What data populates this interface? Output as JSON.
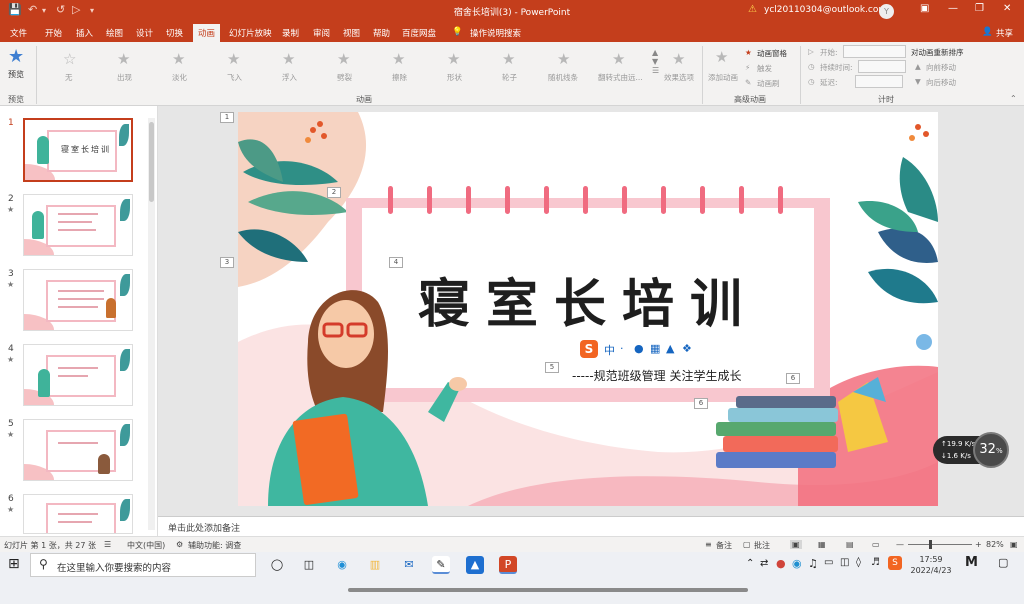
{
  "titlebar": {
    "doc_title": "宿舍长培训(3)  -  PowerPoint",
    "account": "ycl20110304@outlook.com",
    "avatar_letter": "Y",
    "share_label": "共享",
    "warning_icon": "warning-icon"
  },
  "ribbon_tabs": [
    "文件",
    "开始",
    "插入",
    "绘图",
    "设计",
    "切换",
    "动画",
    "幻灯片放映",
    "录制",
    "审阅",
    "视图",
    "帮助",
    "百度网盘"
  ],
  "active_tab": "动画",
  "tell_me": "操作说明搜索",
  "ribbon": {
    "preview": {
      "label": "预览",
      "group": "预览"
    },
    "effects": [
      "无",
      "出现",
      "淡化",
      "飞入",
      "浮入",
      "劈裂",
      "擦除",
      "形状",
      "轮子",
      "随机线条",
      "翻转式由远..."
    ],
    "effect_options": "效果选项",
    "animation_group": "动画",
    "add_animation": "添加动画",
    "animation_pane": "动画窗格",
    "trigger": "触发",
    "animation_painter": "动画刷",
    "advanced_group": "高级动画",
    "start": "开始:",
    "duration": "持续时间:",
    "delay": "延迟:",
    "reorder": "对动画重新排序",
    "move_earlier": "向前移动",
    "move_later": "向后移动",
    "timing_group": "计时"
  },
  "thumbnails": [
    {
      "num": "1",
      "star": "",
      "title": "寝室长培训"
    },
    {
      "num": "2",
      "star": "★",
      "title": ""
    },
    {
      "num": "3",
      "star": "★",
      "title": ""
    },
    {
      "num": "4",
      "star": "★",
      "title": ""
    },
    {
      "num": "5",
      "star": "★",
      "title": ""
    },
    {
      "num": "6",
      "star": "★",
      "title": ""
    }
  ],
  "slide": {
    "title": "寝室长培训",
    "subtitle": "-----规范班级管理 关注学生成长",
    "anim_tags": [
      "1",
      "2",
      "3",
      "4",
      "5",
      "6",
      "6"
    ],
    "ime_bar": [
      "中",
      "·",
      "mic",
      "grid",
      "shirt",
      "apps"
    ]
  },
  "notes_placeholder": "单击此处添加备注",
  "status": {
    "slide_info": "幻灯片 第 1 张，共 27 张",
    "language": "中文(中国)",
    "accessibility": "辅助功能: 调查",
    "notes": "备注",
    "comments": "批注",
    "zoom": "82%"
  },
  "net_widget": {
    "upload": "19.9",
    "upload_unit": "K/s",
    "download": "1.6",
    "download_unit": "K/s",
    "percent": "32"
  },
  "taskbar": {
    "search_placeholder": "在这里输入你要搜索的内容",
    "time": "17:59",
    "date": "2022/4/23"
  }
}
